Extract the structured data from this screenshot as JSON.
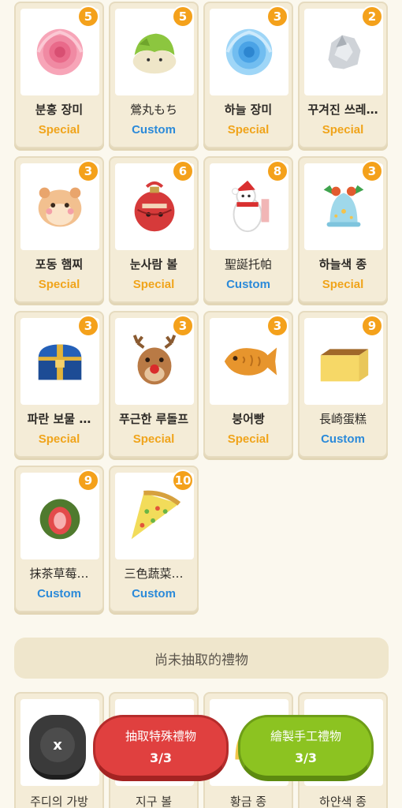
{
  "gifts": [
    {
      "name": "분홍 장미",
      "tier": "Special",
      "count": "5",
      "icon": "pink-rose-icon"
    },
    {
      "name": "鶯丸もち",
      "tier": "Custom",
      "count": "5",
      "icon": "green-mochi-icon"
    },
    {
      "name": "하늘 장미",
      "tier": "Special",
      "count": "3",
      "icon": "sky-blue-rose-icon"
    },
    {
      "name": "꾸겨진 쓰레…",
      "tier": "Special",
      "count": "2",
      "icon": "crumpled-paper-icon"
    },
    {
      "name": "포동 햄찌",
      "tier": "Special",
      "count": "3",
      "icon": "hamster-icon"
    },
    {
      "name": "눈사람 볼",
      "tier": "Special",
      "count": "6",
      "icon": "snowman-ornament-icon"
    },
    {
      "name": "聖誕托帕",
      "tier": "Custom",
      "count": "8",
      "icon": "christmas-polar-bear-icon"
    },
    {
      "name": "하늘색 종",
      "tier": "Special",
      "count": "3",
      "icon": "blue-bell-icon"
    },
    {
      "name": "파란 보물 …",
      "tier": "Special",
      "count": "3",
      "icon": "treasure-chest-icon"
    },
    {
      "name": "푸근한 루돌프",
      "tier": "Special",
      "count": "3",
      "icon": "reindeer-icon"
    },
    {
      "name": "붕어빵",
      "tier": "Special",
      "count": "3",
      "icon": "taiyaki-icon"
    },
    {
      "name": "長崎蛋糕",
      "tier": "Custom",
      "count": "9",
      "icon": "castella-cake-icon"
    },
    {
      "name": "抹茶草莓…",
      "tier": "Custom",
      "count": "9",
      "icon": "matcha-strawberry-icon"
    },
    {
      "name": "三色蔬菜…",
      "tier": "Custom",
      "count": "10",
      "icon": "pizza-slice-icon"
    }
  ],
  "undrawn_section": {
    "title": "尚未抽取的禮物",
    "items": [
      {
        "name": "주디의 가방",
        "icon": "bag-icon"
      },
      {
        "name": "지구 볼",
        "icon": "earth-ornament-icon"
      },
      {
        "name": "황금 종",
        "icon": "gold-bell-icon"
      },
      {
        "name": "하얀색 종",
        "icon": "white-bell-icon"
      }
    ]
  },
  "buttons": {
    "close": "x",
    "draw_special": {
      "label": "抽取特殊禮物",
      "progress": "3/3"
    },
    "make_custom": {
      "label": "繪製手工禮物",
      "progress": "3/3"
    }
  },
  "colors": {
    "special": "#f0a41b",
    "custom": "#2b8ad9",
    "badge": "#f4a11b",
    "red_button": "#e0403f",
    "green_button": "#8cc321"
  }
}
